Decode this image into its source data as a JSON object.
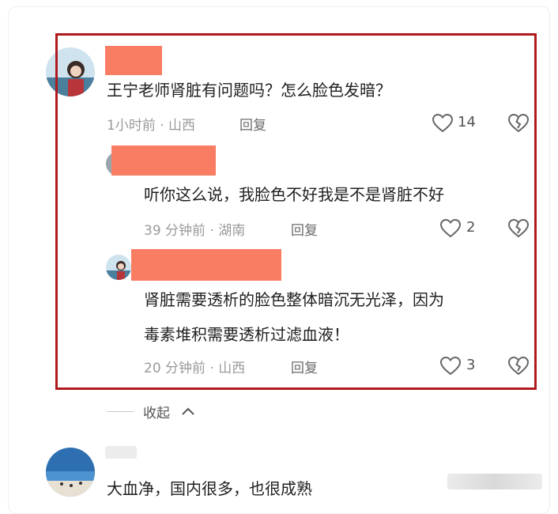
{
  "comments": [
    {
      "text": "王宁老师肾脏有问题吗？怎么脸色发暗？",
      "time_location": "1小时前 · 山西",
      "reply_label": "回复",
      "likes": "14"
    },
    {
      "text": "听你这么说，我脸色不好我是不是肾脏不好",
      "time_location": "39 分钟前 · 湖南",
      "reply_label": "回复",
      "likes": "2"
    },
    {
      "text_line1": "肾脏需要透析的脸色整体暗沉无光泽，因为",
      "text_line2": "毒素堆积需要透析过滤血液！",
      "time_location": "20 分钟前 · 山西",
      "reply_label": "回复",
      "likes": "3"
    }
  ],
  "collapse_label": "收起",
  "bottom_comment": {
    "text": "大血净，国内很多，也很成熟"
  },
  "colors": {
    "highlight_border": "#b0191e",
    "redaction": "#f97d63"
  },
  "icons": [
    "heart-icon",
    "broken-heart-icon",
    "chevron-up-icon"
  ]
}
